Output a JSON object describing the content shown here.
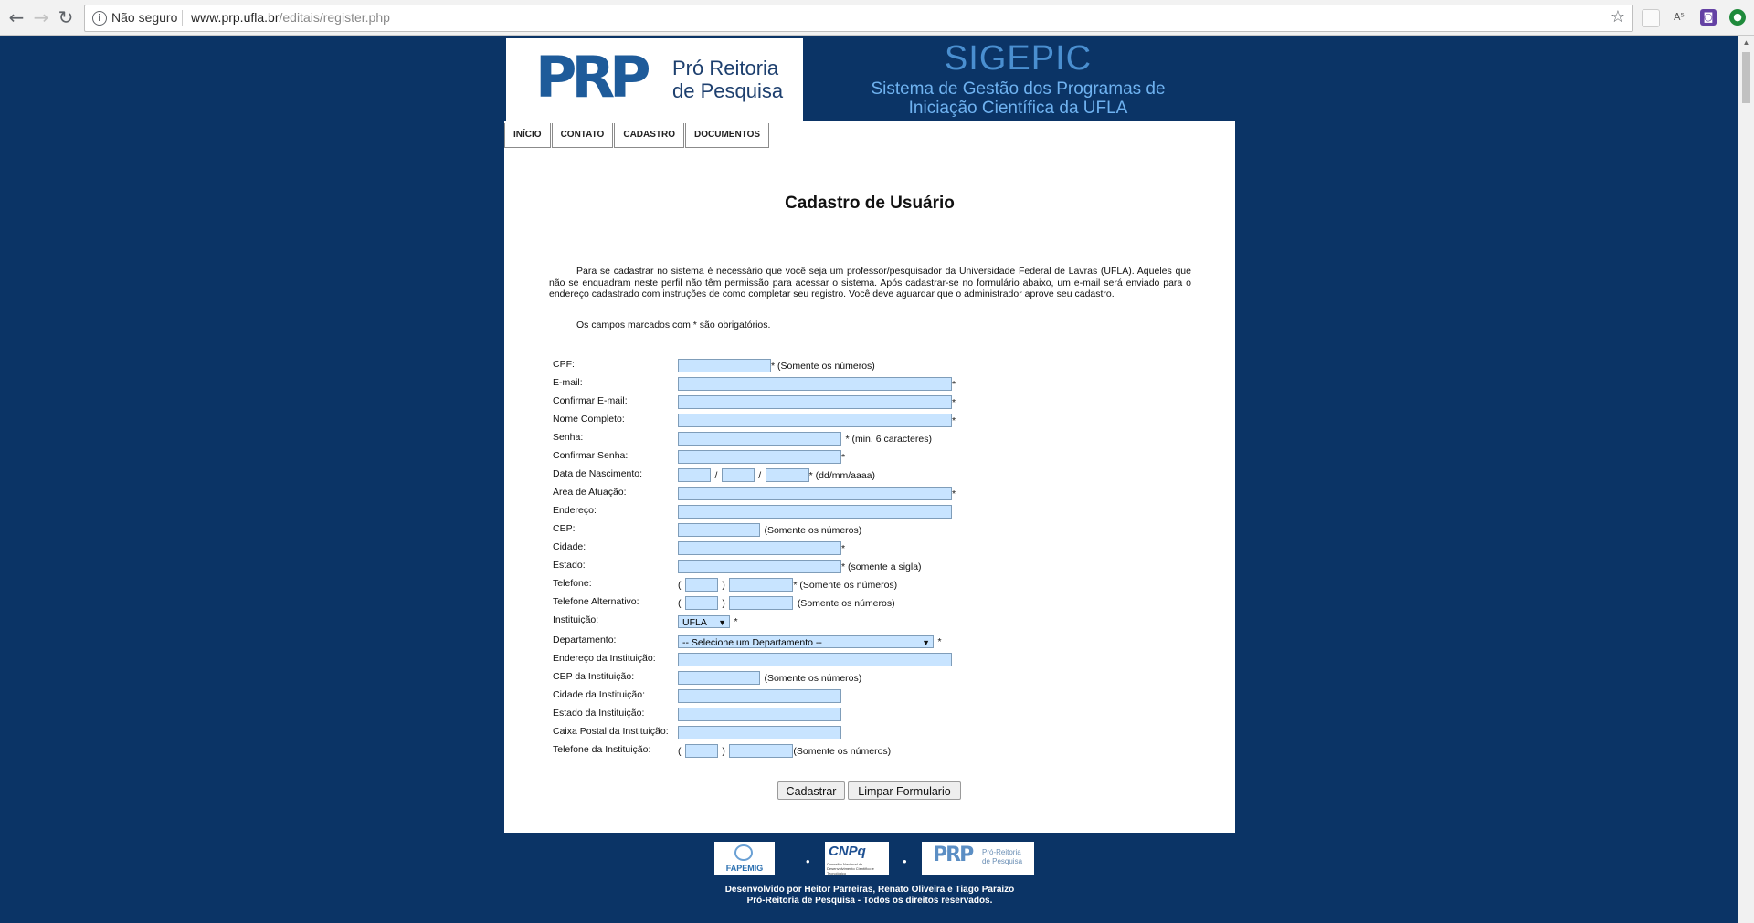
{
  "browser": {
    "security_text": "Não seguro",
    "url_host": "www.prp.ufla.br",
    "url_path": "/editais/register.php"
  },
  "header": {
    "logo_mark": "PRP",
    "logo_line1": "Pró Reitoria",
    "logo_line2": "de Pesquisa",
    "system_title": "SIGEPIC",
    "system_sub1": "Sistema de Gestão dos Programas de",
    "system_sub2": "Iniciação Científica da UFLA"
  },
  "menu": [
    "INÍCIO",
    "CONTATO",
    "CADASTRO",
    "DOCUMENTOS"
  ],
  "page": {
    "title": "Cadastro de Usuário",
    "intro": "Para se cadastrar no sistema é necessário que você seja um professor/pesquisador da Universidade Federal de Lavras (UFLA). Aqueles que não se enquadram neste perfil não têm permissão para acessar o sistema. Após cadastrar-se no formulário abaixo, um e-mail será enviado para o endereço cadastrado com instruções de como completar seu registro. Você deve aguardar que o administrador aprove seu cadastro.",
    "required_note": "Os campos marcados com * são obrigatórios."
  },
  "form": {
    "cpf": "CPF:",
    "email": "E-mail:",
    "confirm_email": "Confirmar E-mail:",
    "full_name": "Nome Completo:",
    "password": "Senha:",
    "confirm_password": "Confirmar Senha:",
    "birth_date": "Data de Nascimento:",
    "area": "Area de Atuação:",
    "address": "Endereço:",
    "cep": "CEP:",
    "city": "Cidade:",
    "state": "Estado:",
    "phone": "Telefone:",
    "alt_phone": "Telefone Alternativo:",
    "institution": "Instituição:",
    "department": "Departamento:",
    "inst_address": "Endereço da Instituição:",
    "inst_cep": "CEP da Instituição:",
    "inst_city": "Cidade da Instituição:",
    "inst_state": "Estado da Instituição:",
    "inst_pobox": "Caixa Postal da Instituição:",
    "inst_phone": "Telefone da Instituição:"
  },
  "hints": {
    "only_numbers_req": "* (Somente os números)",
    "only_numbers": "(Somente os números)",
    "min_chars": "* (min. 6 caracteres)",
    "date_fmt": "* (dd/mm/aaaa)",
    "acronym": "* (somente a sigla)",
    "star": "*",
    "slash": "/",
    "paren_open": "(",
    "paren_close": ")"
  },
  "selects": {
    "institution": "UFLA",
    "department": "-- Selecione um Departamento --"
  },
  "buttons": {
    "submit": "Cadastrar",
    "reset": "Limpar Formulario"
  },
  "footer": {
    "logo1": "FAPEMIG",
    "logo2": "CNPq",
    "logo2_small": "Conselho Nacional de Desenvolvimento Científico e Tecnológico",
    "logo3_mark": "PRP",
    "logo3_text": "Pró-Reitoria de Pesquisa",
    "credits1": "Desenvolvido por Heitor Parreiras, Renato Oliveira e Tiago Paraizo",
    "credits2": "Pró-Reitoria de Pesquisa - Todos os direitos reservados."
  },
  "colors": {
    "background": "#0b3466",
    "input_fill": "#c8e4ff",
    "header_title": "#4a8fd0"
  }
}
